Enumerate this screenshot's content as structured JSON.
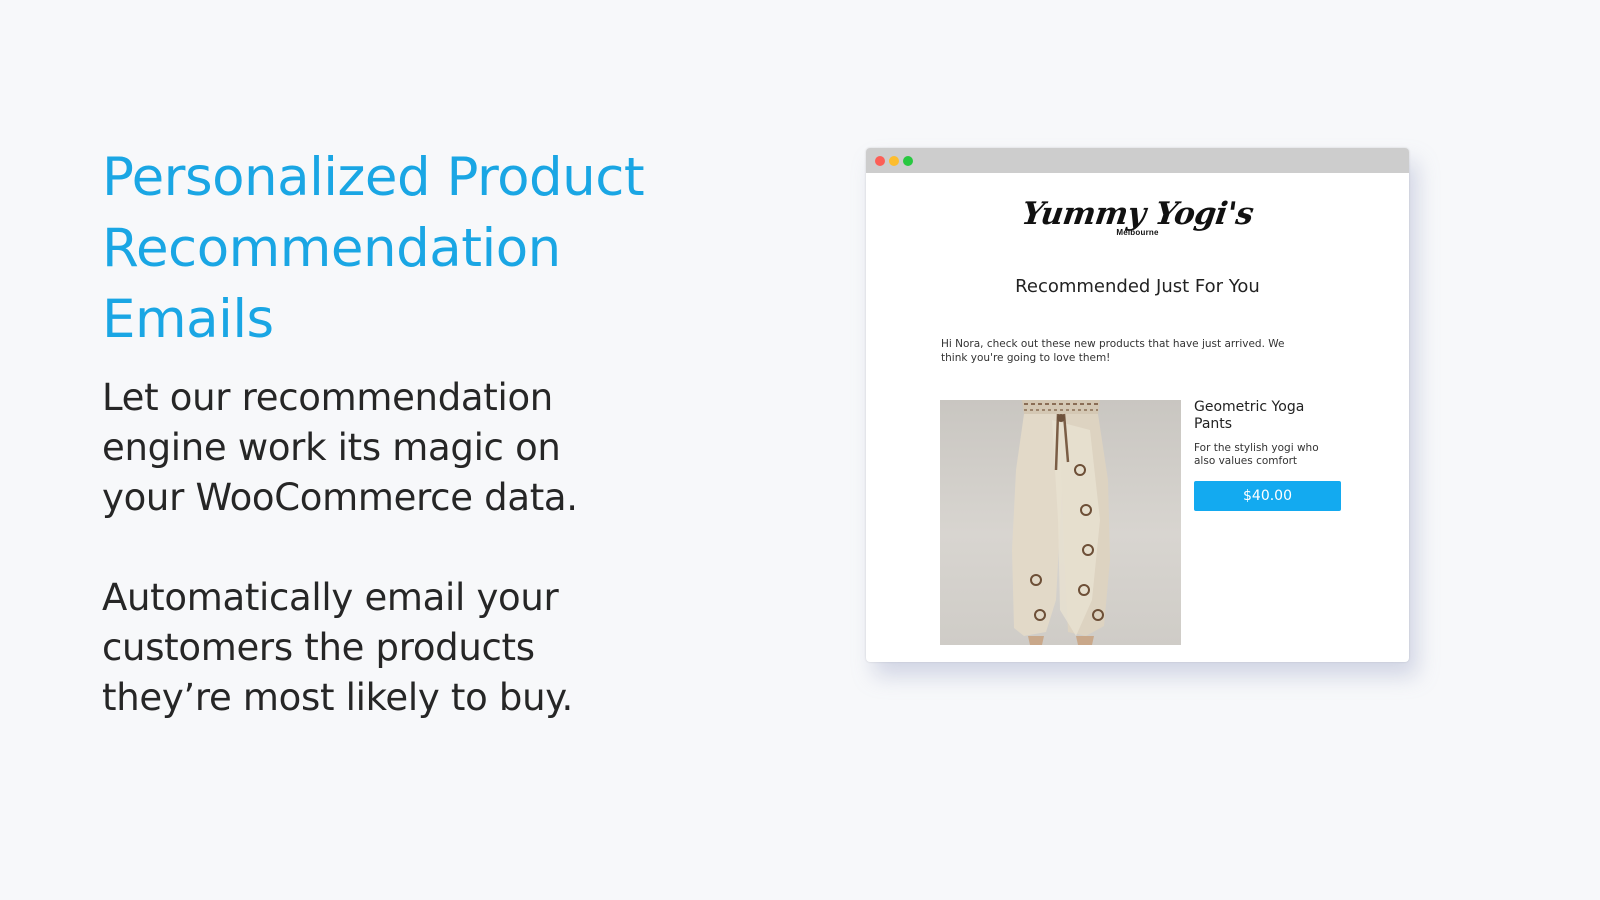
{
  "headline": {
    "lines": [
      "Personalized Product",
      "Recommendation",
      "Emails"
    ]
  },
  "copy": {
    "paragraph1": [
      "Let our recommendation",
      "engine work its magic on",
      "your WooCommerce data."
    ],
    "paragraph2": [
      "Automatically email your",
      "customers the products",
      "they’re most likely to buy."
    ]
  },
  "email": {
    "logo": "Yummy Yogi's",
    "logo_sub": "Melbourne",
    "heading": "Recommended Just For You",
    "intro": [
      "Hi Nora, check out these new products that have just arrived. We",
      "think you're going to love them!"
    ],
    "product": {
      "name": [
        "Geometric Yoga",
        "Pants"
      ],
      "description": [
        "For the stylish yogi who",
        "also values comfort"
      ],
      "price": "$40.00",
      "image_alt": "Geometric Yoga Pants product photo"
    }
  },
  "colors": {
    "accent": "#1aa6e4",
    "button": "#13aaf0",
    "background": "#f7f8fa"
  },
  "icons": {
    "window_controls": [
      "close-dot",
      "minimize-dot",
      "maximize-dot"
    ]
  }
}
